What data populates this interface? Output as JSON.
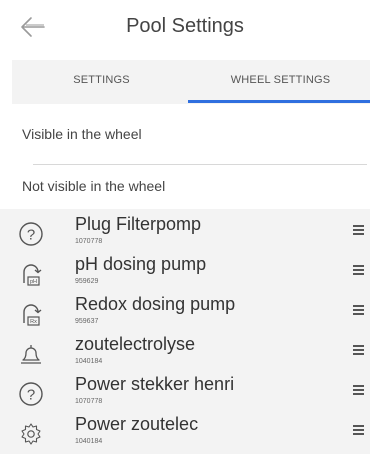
{
  "header": {
    "title": "Pool Settings",
    "back_icon": "back-arrow-icon"
  },
  "tabs": [
    {
      "label": "SETTINGS",
      "active": false
    },
    {
      "label": "WHEEL SETTINGS",
      "active": true
    }
  ],
  "accent_color": "#2f6fdf",
  "sections": {
    "visible_label": "Visible in the wheel",
    "not_visible_label": "Not visible in the wheel"
  },
  "items": [
    {
      "name": "Plug Filterpomp",
      "id": "1070778",
      "icon": "question-icon"
    },
    {
      "name": "pH dosing pump",
      "id": "959629",
      "icon": "ph-pump-icon"
    },
    {
      "name": "Redox dosing pump",
      "id": "959637",
      "icon": "rx-pump-icon"
    },
    {
      "name": "zoutelectrolyse",
      "id": "1040184",
      "icon": "bell-icon"
    },
    {
      "name": "Power stekker henri",
      "id": "1070778",
      "icon": "question-icon"
    },
    {
      "name": "Power zoutelec",
      "id": "1040184",
      "icon": "gear-icon"
    }
  ]
}
